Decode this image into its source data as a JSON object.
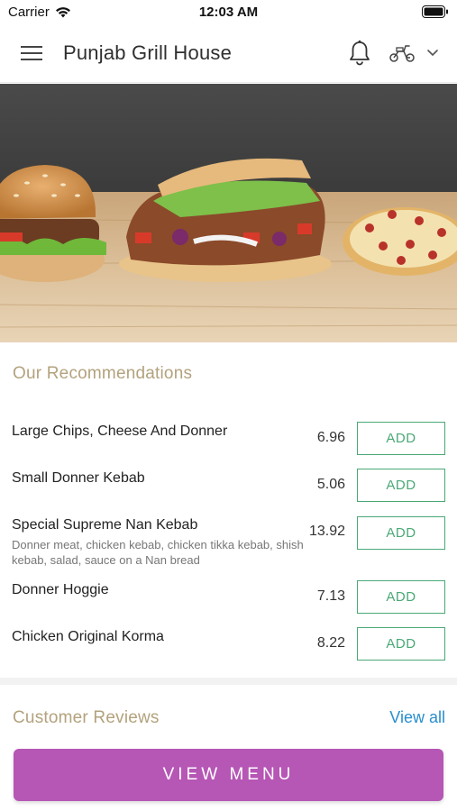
{
  "status_bar": {
    "carrier": "Carrier",
    "time": "12:03 AM"
  },
  "header": {
    "title": "Punjab Grill House",
    "icons": [
      "menu-icon",
      "bell-icon",
      "scooter-icon",
      "chevron-down-icon"
    ]
  },
  "hero": {
    "icon": "food-banner-image"
  },
  "recommendations": {
    "title": "Our Recommendations",
    "add_label": "ADD",
    "items": [
      {
        "name": "Large Chips, Cheese And Donner",
        "price": "6.96",
        "description": ""
      },
      {
        "name": "Small Donner Kebab",
        "price": "5.06",
        "description": ""
      },
      {
        "name": "Special Supreme Nan Kebab",
        "price": "13.92",
        "description": "Donner meat, chicken kebab, chicken tikka kebab, shish kebab, salad, sauce on a Nan bread"
      },
      {
        "name": "Donner Hoggie",
        "price": "7.13",
        "description": ""
      },
      {
        "name": "Chicken Original Korma",
        "price": "8.22",
        "description": ""
      }
    ]
  },
  "reviews": {
    "title": "Customer Reviews",
    "view_all": "View all"
  },
  "footer": {
    "view_menu": "VIEW MENU"
  },
  "colors": {
    "accent": "#b656b5",
    "add_green": "#4aa876",
    "section_title": "#b3a27d",
    "link_blue": "#2a8fcd"
  }
}
